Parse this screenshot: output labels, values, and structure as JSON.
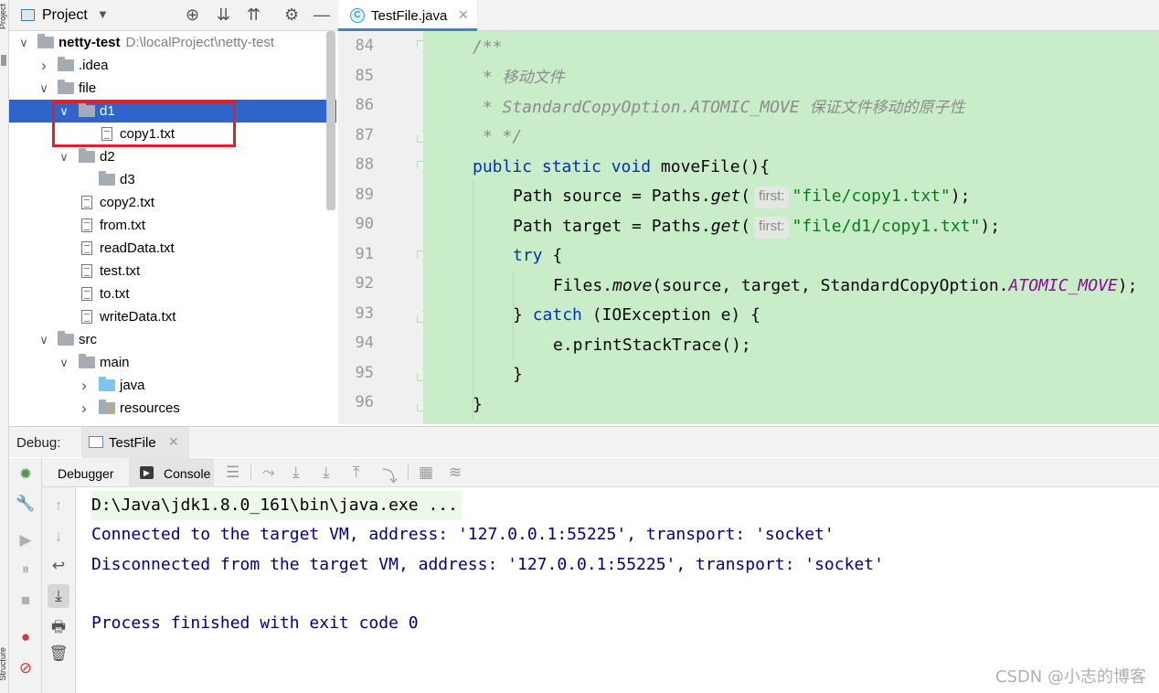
{
  "left_strip": {
    "top_label": "Project",
    "bottom_label": "Structure"
  },
  "project_panel": {
    "title": "Project",
    "header_icons": [
      "locate-icon",
      "expand-all-icon",
      "collapse-all-icon",
      "gear-icon",
      "minimize-icon"
    ],
    "tree": [
      {
        "label": "netty-test",
        "path": "D:\\localProject\\netty-test",
        "type": "module",
        "expanded": true,
        "level": 0
      },
      {
        "label": ".idea",
        "type": "folder",
        "expanded": false,
        "level": 1
      },
      {
        "label": "file",
        "type": "folder",
        "expanded": true,
        "level": 1
      },
      {
        "label": "d1",
        "type": "folder",
        "expanded": true,
        "level": 2,
        "selected": true
      },
      {
        "label": "copy1.txt",
        "type": "file",
        "level": 3
      },
      {
        "label": "d2",
        "type": "folder",
        "expanded": true,
        "level": 2
      },
      {
        "label": "d3",
        "type": "folder",
        "level": 3
      },
      {
        "label": "copy2.txt",
        "type": "file",
        "level": 2
      },
      {
        "label": "from.txt",
        "type": "file",
        "level": 2
      },
      {
        "label": "readData.txt",
        "type": "file",
        "level": 2
      },
      {
        "label": "test.txt",
        "type": "file",
        "level": 2
      },
      {
        "label": "to.txt",
        "type": "file",
        "level": 2
      },
      {
        "label": "writeData.txt",
        "type": "file",
        "level": 2
      },
      {
        "label": "src",
        "type": "folder",
        "expanded": true,
        "level": 1
      },
      {
        "label": "main",
        "type": "folder",
        "expanded": true,
        "level": 2
      },
      {
        "label": "java",
        "type": "source-folder",
        "expanded": false,
        "level": 3
      },
      {
        "label": "resources",
        "type": "resources-folder",
        "expanded": false,
        "level": 3
      }
    ]
  },
  "editor": {
    "tab": {
      "label": "TestFile.java",
      "icon": "java-class-icon"
    },
    "line_numbers": [
      "84",
      "85",
      "86",
      "87",
      "88",
      "89",
      "90",
      "91",
      "92",
      "93",
      "94",
      "95",
      "96"
    ],
    "code": {
      "l84": "/**",
      "l85_star": " * ",
      "l85_text": "移动文件",
      "l86_star": " * StandardCopyOption.ATOMIC_MOVE ",
      "l86_text": "保证文件移动的原子性",
      "l87": " * */",
      "l88_mods": "public static void",
      "l88_rest": " moveFile(){",
      "l89_pre": "Path source = Paths.",
      "l89_method": "get",
      "l89_paren": "(",
      "l89_hint": "first:",
      "l89_str": "\"file/copy1.txt\"",
      "l89_end": ");",
      "l90_pre": "Path target = Paths.",
      "l90_method": "get",
      "l90_paren": "(",
      "l90_hint": "first:",
      "l90_str": "\"file/d1/copy1.txt\"",
      "l90_end": ");",
      "l91_kw": "try",
      "l91_rest": " {",
      "l92_pre": "Files.",
      "l92_method": "move",
      "l92_mid": "(source, target, StandardCopyOption.",
      "l92_const": "ATOMIC_MOVE",
      "l92_end": ");",
      "l93_pre": "} ",
      "l93_kw": "catch",
      "l93_rest": " (IOException e) {",
      "l94": "e.printStackTrace();",
      "l95": "}",
      "l96": "}"
    }
  },
  "debug": {
    "label": "Debug:",
    "session_tab": "TestFile",
    "tabs": {
      "debugger": "Debugger",
      "console": "Console"
    },
    "console_lines": [
      "D:\\Java\\jdk1.8.0_161\\bin\\java.exe ...",
      "Connected to the target VM, address: '127.0.0.1:55225', transport: 'socket'",
      "Disconnected from the target VM, address: '127.0.0.1:55225', transport: 'socket'",
      "",
      "Process finished with exit code 0"
    ]
  },
  "watermark": "CSDN @小志的博客",
  "colors": {
    "selection": "#2f65ca",
    "editor_bg": "#c9ecc9",
    "keyword": "#0033b3",
    "string": "#067d17",
    "console_text": "#000080",
    "highlight_box": "#e0202a"
  }
}
